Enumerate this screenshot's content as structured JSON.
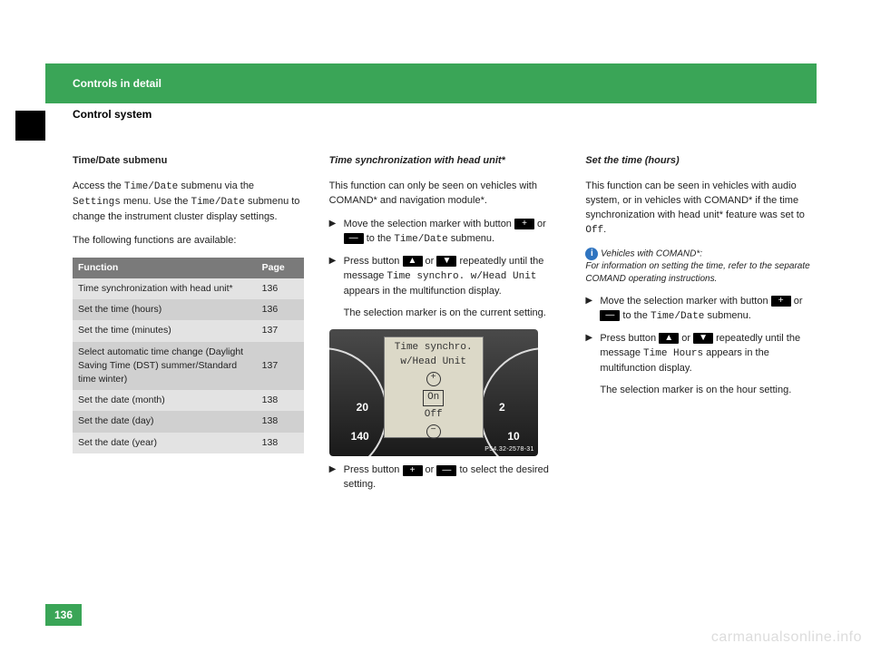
{
  "header": {
    "chapter": "Controls in detail",
    "section": "Control system"
  },
  "col1": {
    "title": "Time/Date submenu",
    "para1a": "Access the ",
    "para1b": " submenu via the ",
    "para1c": " menu. Use the ",
    "para1d": " submenu to change the instrument cluster display settings.",
    "m_timedate": "Time/Date",
    "m_settings": "Settings",
    "para2": "The following functions are available:",
    "th_func": "Function",
    "th_page": "Page",
    "rows": [
      {
        "f": "Time synchronization with head unit*",
        "p": "136"
      },
      {
        "f": "Set the time (hours)",
        "p": "136"
      },
      {
        "f": "Set the time (minutes)",
        "p": "137"
      },
      {
        "f": "Select automatic time change (Daylight Saving Time (DST) summer/Standard time winter)",
        "p": "137"
      },
      {
        "f": "Set the date (month)",
        "p": "138"
      },
      {
        "f": "Set the date (day)",
        "p": "138"
      },
      {
        "f": "Set the date (year)",
        "p": "138"
      }
    ]
  },
  "col2": {
    "title": "Time synchronization with head unit*",
    "intro": "This function can only be seen on vehicles with COMAND* and navigation module*.",
    "step1a": "Move the selection marker with button ",
    "step1b": " or ",
    "step1c": " to the ",
    "step1d": " submenu.",
    "step2a": "Press button ",
    "step2b": " or ",
    "step2c": " repeatedly until the message ",
    "step2d": " appears in the multifunction display.",
    "m_sync": "Time synchro. w/Head Unit",
    "m_timedate": "Time/Date",
    "after": "The selection marker is on the current setting.",
    "display": {
      "l1": "Time synchro.",
      "l2": "w/Head Unit",
      "on": "On",
      "off": "Off"
    },
    "gauges": {
      "g20": "20",
      "g2": "2",
      "g140": "140",
      "g10": "10"
    },
    "fig_id": "P54.32-2578-31",
    "step3a": "Press button ",
    "step3b": " or ",
    "step3c": " to select the desired setting."
  },
  "col3": {
    "title": "Set the time (hours)",
    "intro_a": "This function can be seen in vehicles with audio system, or in vehicles with COMAND* if the time synchronization with head unit* feature was set to ",
    "intro_b": ".",
    "m_off": "Off",
    "note_lead": "Vehicles with COMAND*:",
    "note_body": "For information on setting the time, refer to the separate COMAND operating instructions.",
    "step1a": "Move the selection marker with button ",
    "step1b": " or ",
    "step1c": " to the ",
    "step1d": " submenu.",
    "m_timedate": "Time/Date",
    "step2a": "Press button ",
    "step2b": " or ",
    "step2c": " repeatedly until the message ",
    "step2d": " appears in the multifunction display.",
    "m_hours": "Time Hours",
    "after": "The selection marker is on the hour setting."
  },
  "btn": {
    "plus": "+",
    "minus": "—",
    "up": "▲",
    "down": "▼"
  },
  "page_number": "136",
  "watermark": "carmanualsonline.info"
}
